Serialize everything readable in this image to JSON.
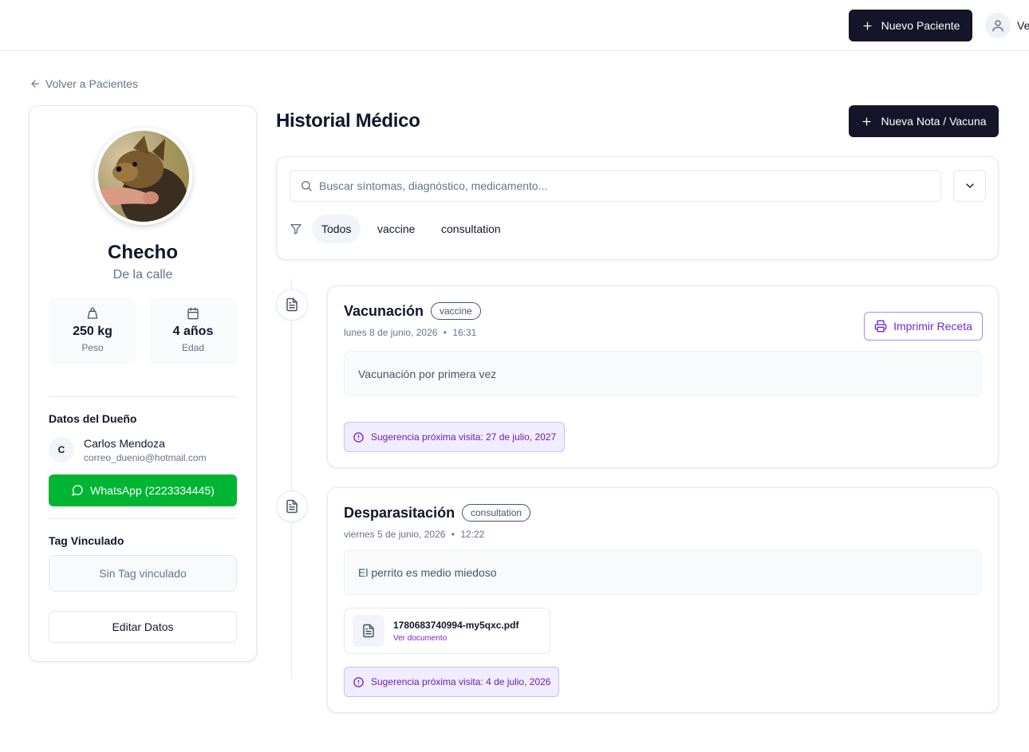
{
  "header": {
    "new_patient_label": "Nuevo Paciente",
    "user_name": "Ve"
  },
  "nav": {
    "back_label": "Volver a Pacientes"
  },
  "patient": {
    "name": "Checho",
    "breed": "De la calle",
    "weight_value": "250 kg",
    "weight_label": "Peso",
    "age_value": "4 años",
    "age_label": "Edad",
    "owner_section_title": "Datos del Dueño",
    "owner_initial": "C",
    "owner_name": "Carlos Mendoza",
    "owner_email": "correo_duenio@hotmail.com",
    "whatsapp_label": "WhatsApp (2223334445)",
    "tag_section_title": "Tag Vinculado",
    "tag_status": "Sin Tag vinculado",
    "edit_label": "Editar Datos"
  },
  "history": {
    "title": "Historial Médico",
    "new_note_label": "Nueva Nota / Vacuna",
    "search_placeholder": "Buscar síntomas, diagnóstico, medicamento...",
    "filters": [
      "Todos",
      "vaccine",
      "consultation"
    ],
    "active_filter": "Todos",
    "entries": [
      {
        "title": "Vacunación",
        "type": "vaccine",
        "date": "lunes 8 de junio, 2026",
        "time": "16:31",
        "note": "Vacunación por primera vez",
        "print_label": "Imprimir Receta",
        "suggestion": "Sugerencia próxima visita: 27 de julio, 2027"
      },
      {
        "title": "Desparasitación",
        "type": "consultation",
        "date": "viernes 5 de junio, 2026",
        "time": "12:22",
        "note": "El perrito es medio miedoso",
        "document_name": "1780683740994-my5qxc.pdf",
        "document_link": "Ver documento",
        "suggestion": "Sugerencia próxima visita: 4 de julio, 2026"
      }
    ]
  },
  "colors": {
    "primary_dark": "#151529",
    "whatsapp_green": "#00b533",
    "accent_purple": "#6d28d9",
    "suggestion_bg": "#f1edff"
  }
}
